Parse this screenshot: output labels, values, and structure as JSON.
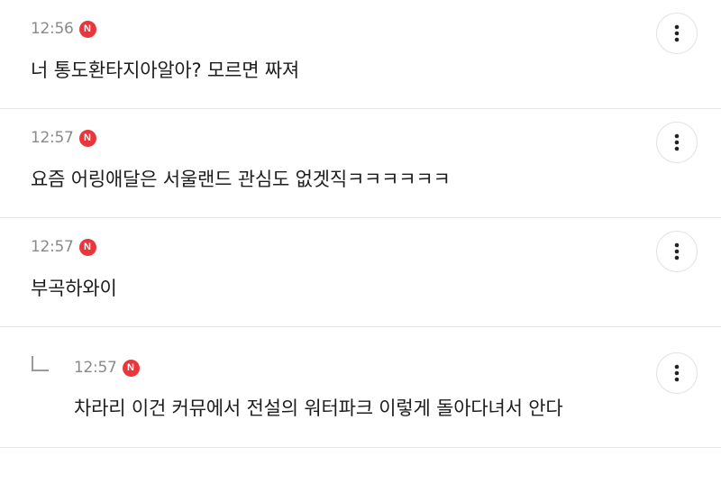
{
  "comments": [
    {
      "time": "12:56",
      "badge": "N",
      "text": "너 통도환타지아알아? 모르면 짜져",
      "is_reply": false
    },
    {
      "time": "12:57",
      "badge": "N",
      "text": "요즘 어링애달은 서울랜드 관심도 없겟직ㅋㅋㅋㅋㅋㅋ",
      "is_reply": false
    },
    {
      "time": "12:57",
      "badge": "N",
      "text": "부곡하와이",
      "is_reply": false
    },
    {
      "time": "12:57",
      "badge": "N",
      "text": "차라리 이건 커뮤에서 전설의 워터파크 이렇게 돌아다녀서 안다",
      "is_reply": true
    }
  ],
  "icons": {
    "more": "more-vertical-icon",
    "reply": "reply-arrow-icon"
  },
  "colors": {
    "badge": "#e8363c",
    "time": "#8a8a8a",
    "divider": "#e6e6e6"
  }
}
